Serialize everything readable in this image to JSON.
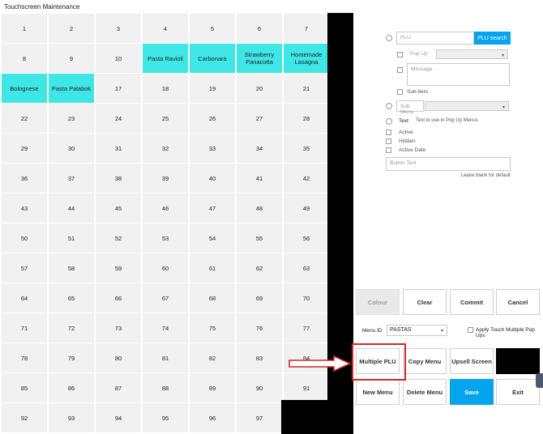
{
  "window": {
    "title": "Touchscreen Maintenance"
  },
  "grid": {
    "cells": [
      "1",
      "2",
      "3",
      "4",
      "5",
      "6",
      "7",
      "8",
      "9",
      "10",
      "Pasta Ravioli",
      "Carbonara",
      "Strawberry Panacotta",
      "Homemade Lasagna",
      "Bolognese",
      "Pasta Palabok",
      "17",
      "18",
      "19",
      "20",
      "21",
      "22",
      "23",
      "24",
      "25",
      "26",
      "27",
      "28",
      "29",
      "30",
      "31",
      "32",
      "33",
      "34",
      "35",
      "36",
      "37",
      "38",
      "39",
      "40",
      "41",
      "42",
      "43",
      "44",
      "45",
      "46",
      "47",
      "48",
      "49",
      "50",
      "51",
      "52",
      "53",
      "54",
      "55",
      "56",
      "57",
      "58",
      "59",
      "60",
      "61",
      "62",
      "63",
      "64",
      "65",
      "66",
      "67",
      "68",
      "69",
      "70",
      "71",
      "72",
      "73",
      "74",
      "75",
      "76",
      "77",
      "78",
      "79",
      "80",
      "81",
      "82",
      "83",
      "84",
      "85",
      "86",
      "87",
      "88",
      "89",
      "90",
      "91",
      "92",
      "93",
      "94",
      "95",
      "96",
      "97"
    ],
    "highlighted": [
      10,
      11,
      12,
      13,
      14,
      15
    ],
    "highlight_color": "#3ee6e6"
  },
  "form": {
    "plu_placeholder": "PLU",
    "plu_search_label": "PLU search",
    "popup_placeholder": "Pop Up",
    "message_placeholder": "Message",
    "subitem_label": "Sub-item",
    "submenu_placeholder": "Sub Menu",
    "text_label": "Text",
    "text_hint": "Text to use in Pop Up Menus",
    "active_label": "Active",
    "hidden_label": "Hidden",
    "active_date_label": "Active Date",
    "button_text_placeholder": "Button Text",
    "button_text_hint": "Leave blank for default"
  },
  "actions": {
    "colour": "Colour",
    "clear": "Clear",
    "commit": "Commit",
    "cancel": "Cancel"
  },
  "menu": {
    "menu_id_label": "Menu ID",
    "menu_id_value": "PASTAS",
    "apply_touch_label": "Apply Touch Multiple Pop Ups"
  },
  "buttons": {
    "multiple_plu": "Multiple PLU",
    "copy_menu": "Copy Menu",
    "upsell_screen": "Upsell Screen",
    "new_menu": "New Menu",
    "delete_menu": "Delete Menu",
    "save": "Save",
    "exit": "Exit"
  },
  "colors": {
    "accent": "#05a4ee",
    "annotation": "#cc2a2a"
  }
}
